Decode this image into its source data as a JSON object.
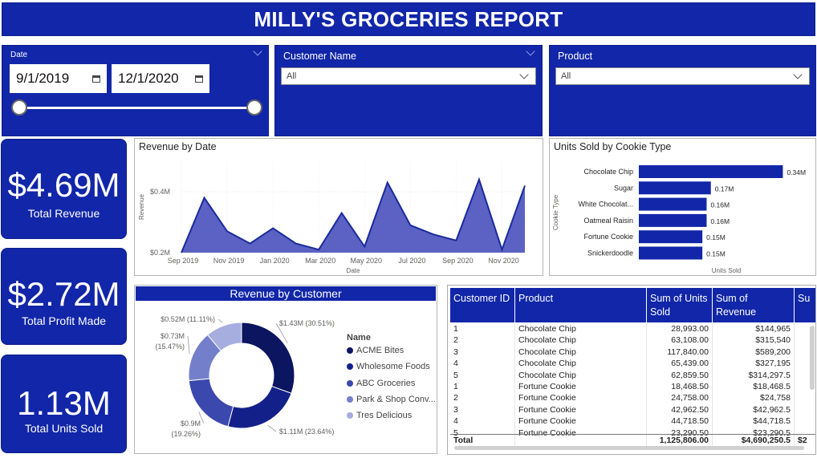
{
  "report": {
    "title": "MILLY'S GROCERIES REPORT"
  },
  "colors": {
    "navy": "#1126a8",
    "area": "#5b62c4",
    "line": "#1a2a9c",
    "bar": "#1126a8"
  },
  "filters": {
    "date": {
      "label": "Date",
      "start": "9/1/2019",
      "end": "12/1/2020"
    },
    "customer": {
      "label": "Customer Name",
      "value": "All"
    },
    "product": {
      "label": "Product",
      "value": "All"
    }
  },
  "kpis": {
    "revenue": {
      "value": "$4.69M",
      "label": "Total Revenue"
    },
    "profit": {
      "value": "$2.72M",
      "label": "Total Profit Made"
    },
    "units": {
      "value": "1.13M",
      "label": "Total Units Sold"
    }
  },
  "chart_data": [
    {
      "type": "area",
      "title": "Revenue by Date",
      "xlabel": "Date",
      "ylabel": "Revenue",
      "x": [
        "Sep 2019",
        "Oct 2019",
        "Nov 2019",
        "Dec 2019",
        "Jan 2020",
        "Feb 2020",
        "Mar 2020",
        "Apr 2020",
        "May 2020",
        "Jun 2020",
        "Jul 2020",
        "Aug 2020",
        "Sep 2020",
        "Oct 2020",
        "Nov 2020",
        "Dec 2020"
      ],
      "xticks": [
        "Sep 2019",
        "Nov 2019",
        "Jan 2020",
        "Mar 2020",
        "May 2020",
        "Jul 2020",
        "Sep 2020",
        "Nov 2020"
      ],
      "yticks": [
        {
          "value": 0.2,
          "label": "$0.2M"
        },
        {
          "value": 0.4,
          "label": "$0.4M"
        }
      ],
      "values": [
        0.2,
        0.38,
        0.27,
        0.23,
        0.28,
        0.23,
        0.21,
        0.33,
        0.22,
        0.43,
        0.29,
        0.26,
        0.24,
        0.44,
        0.21,
        0.42
      ],
      "ylim": [
        0.2,
        0.5
      ]
    },
    {
      "type": "bar",
      "title": "Units Sold by Cookie Type",
      "xlabel": "Units Sold",
      "ylabel": "Cookie Type",
      "categories": [
        "Chocolate Chip",
        "Sugar",
        "White Chocolat...",
        "Oatmeal Raisin",
        "Fortune Cookie",
        "Snickerdoodle"
      ],
      "values": [
        0.34,
        0.17,
        0.16,
        0.16,
        0.15,
        0.15
      ],
      "labels": [
        "0.34M",
        "0.17M",
        "0.16M",
        "0.16M",
        "0.15M",
        "0.15M"
      ],
      "xlim": [
        0,
        0.36
      ]
    },
    {
      "type": "pie",
      "title": "Revenue by Customer",
      "legend_title": "Name",
      "categories": [
        "ACME Bites",
        "Wholesome Foods",
        "ABC Groceries",
        "Park & Shop Conv...",
        "Tres Delicious"
      ],
      "values": [
        30.51,
        23.64,
        19.26,
        15.47,
        11.11
      ],
      "labels": [
        [
          "$1.43M (30.51%)"
        ],
        [
          "$1.11M (23.64%)"
        ],
        [
          "$0.9M",
          "(19.26%)"
        ],
        [
          "$0.73M",
          "(15.47%)"
        ],
        [
          "$0.52M (11.11%)"
        ]
      ],
      "colors": [
        "#0b1560",
        "#14208a",
        "#3b48ad",
        "#747fcc",
        "#a6addf"
      ]
    }
  ],
  "table": {
    "headers": [
      "Customer ID",
      "Product",
      "Sum of Units Sold",
      "Sum of Revenue",
      "Su"
    ],
    "rows": [
      [
        "1",
        "Chocolate Chip",
        "28,993.00",
        "$144,965"
      ],
      [
        "2",
        "Chocolate Chip",
        "63,108.00",
        "$315,540"
      ],
      [
        "3",
        "Chocolate Chip",
        "117,840.00",
        "$589,200"
      ],
      [
        "4",
        "Chocolate Chip",
        "65,439.00",
        "$327,195"
      ],
      [
        "5",
        "Chocolate Chip",
        "62,859.50",
        "$314,297.5"
      ],
      [
        "1",
        "Fortune Cookie",
        "18,468.50",
        "$18,468.5"
      ],
      [
        "2",
        "Fortune Cookie",
        "24,758.00",
        "$24,758"
      ],
      [
        "3",
        "Fortune Cookie",
        "42,962.50",
        "$42,962.5"
      ],
      [
        "4",
        "Fortune Cookie",
        "44,718.50",
        "$44,718.5"
      ],
      [
        "5",
        "Fortune Cookie",
        "23,290.50",
        "$23,290.5"
      ]
    ],
    "total": [
      "Total",
      "",
      "1,125,806.00",
      "$4,690,250.5",
      "$2"
    ]
  }
}
